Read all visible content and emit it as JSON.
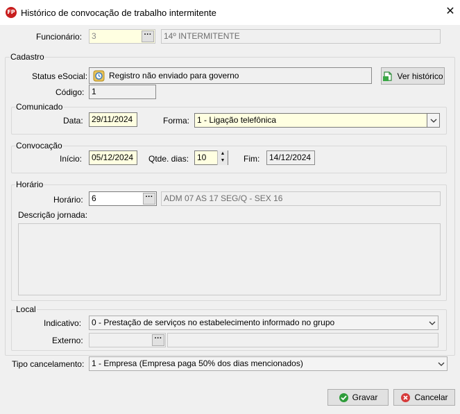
{
  "window": {
    "app_icon_text": "FP",
    "title": "Histórico de convocação de trabalho intermitente",
    "close_glyph": "✕"
  },
  "funcionario": {
    "label": "Funcionário:",
    "value": "3",
    "lookup_label": "···",
    "name": "14º INTERMITENTE"
  },
  "cadastro": {
    "legend": "Cadastro",
    "status_label": "Status eSocial:",
    "status_value": "Registro não enviado para governo",
    "ver_historico_label": "Ver histórico",
    "codigo_label": "Código:",
    "codigo_value": "1"
  },
  "comunicado": {
    "legend": "Comunicado",
    "data_label": "Data:",
    "data_value": "29/11/2024",
    "forma_label": "Forma:",
    "forma_value": "1 - Ligação telefônica"
  },
  "convocacao": {
    "legend": "Convocação",
    "inicio_label": "Início:",
    "inicio_value": "05/12/2024",
    "qtde_label": "Qtde. dias:",
    "qtde_value": "10",
    "fim_label": "Fim:",
    "fim_value": "14/12/2024"
  },
  "horario": {
    "legend": "Horário",
    "horario_label": "Horário:",
    "horario_value": "6",
    "lookup_label": "···",
    "horario_desc": "ADM 07 AS 17 SEG/Q - SEX 16",
    "descricao_label": "Descrição jornada:",
    "descricao_value": ""
  },
  "local": {
    "legend": "Local",
    "indicativo_label": "Indicativo:",
    "indicativo_value": "0 - Prestação de serviços no estabelecimento informado no grupo",
    "externo_label": "Externo:",
    "externo_value": "",
    "lookup_label": "···",
    "externo_desc": ""
  },
  "tipo_cancelamento": {
    "label": "Tipo cancelamento:",
    "value": "1 - Empresa (Empresa paga 50% dos dias mencionados)"
  },
  "buttons": {
    "gravar_label": "Gravar",
    "cancelar_label": "Cancelar"
  },
  "colors": {
    "accent_yellow": "#ffffe1",
    "gravar_icon": "#2e9c3a",
    "cancelar_icon": "#d63a3a",
    "app_icon": "#c81e1e"
  },
  "icons": {
    "app": "fp-logo-icon",
    "close": "close-icon",
    "status": "esocial-status-icon",
    "historico": "document-history-icon",
    "gravar": "check-circle-icon",
    "cancelar": "cancel-circle-icon",
    "dropdown": "chevron-down-icon"
  }
}
